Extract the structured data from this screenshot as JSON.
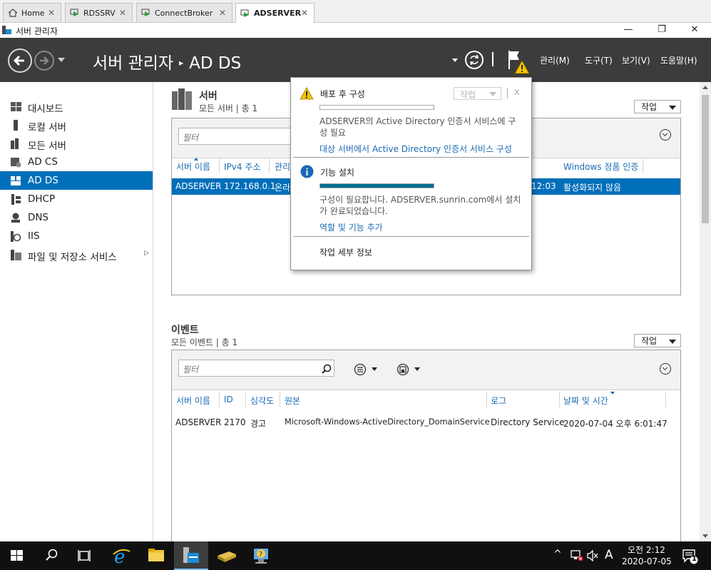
{
  "tabs": [
    {
      "label": "Home",
      "icon": "home-icon"
    },
    {
      "label": "RDSSRV",
      "icon": "remote-desktop-icon"
    },
    {
      "label": "ConnectBroker",
      "icon": "remote-desktop-icon"
    },
    {
      "label": "ADSERVER",
      "icon": "remote-desktop-icon",
      "active": true
    }
  ],
  "window": {
    "title": "서버 관리자",
    "minimize": "—",
    "restore": "❐",
    "close": "✕"
  },
  "header": {
    "app": "서버 관리자",
    "page": "AD DS",
    "menu": [
      "관리(M)",
      "도구(T)",
      "보기(V)",
      "도움말(H)"
    ]
  },
  "sidebar": {
    "items": [
      {
        "label": "대시보드",
        "icon": "dashboard-icon"
      },
      {
        "label": "로컬 서버",
        "icon": "local-server-icon"
      },
      {
        "label": "모든 서버",
        "icon": "all-servers-icon"
      },
      {
        "label": "AD CS",
        "icon": "ad-cs-icon"
      },
      {
        "label": "AD DS",
        "icon": "ad-ds-icon",
        "selected": true
      },
      {
        "label": "DHCP",
        "icon": "dhcp-icon"
      },
      {
        "label": "DNS",
        "icon": "dns-icon"
      },
      {
        "label": "IIS",
        "icon": "iis-icon"
      },
      {
        "label": "파일 및 저장소 서비스",
        "icon": "file-storage-icon",
        "has_arrow": true
      }
    ]
  },
  "servers": {
    "title": "서버",
    "subtitle": "모든 서버 | 총 1",
    "task_label": "작업",
    "filter_placeholder": "필터",
    "columns": [
      "서버 이름",
      "IPv4 주소",
      "관리",
      "Windows 정품 인증"
    ],
    "row": {
      "name": "ADSERVER",
      "ip": "172.168.0.1",
      "manage": "온라",
      "time_fragment": "12:03",
      "activation": "활성화되지 않음"
    }
  },
  "events": {
    "title": "이벤트",
    "subtitle": "모든 이벤트 | 총 1",
    "task_label": "작업",
    "filter_placeholder": "필터",
    "columns": [
      "서버 이름",
      "ID",
      "심각도",
      "원본",
      "로그",
      "날짜 및 시간"
    ],
    "row": {
      "server": "ADSERVER",
      "id": "2170",
      "severity": "경고",
      "source": "Microsoft-Windows-ActiveDirectory_DomainService",
      "log": "Directory Service",
      "datetime": "2020-07-04 오후 6:01:47"
    }
  },
  "notifications": {
    "task_label": "작업",
    "close": "x",
    "items": [
      {
        "icon": "warning-icon",
        "title": "배포 후 구성",
        "progress": 0,
        "text": [
          "ADSERVER의 Active Directory 인증서 서비스에 구",
          "성 필요"
        ],
        "link": "대상 서버에서 Active Directory 인증서 서비스 구성"
      },
      {
        "icon": "info-icon",
        "title": "기능 설치",
        "progress": 1,
        "text": [
          "구성이 필요합니다. ADSERVER.sunrin.com에서 설치",
          "가 완료되었습니다."
        ],
        "link": "역할 및 기능 추가"
      }
    ],
    "footer": "작업 세부 정보"
  },
  "taskbar": {
    "time": "오전 2:12",
    "date": "2020-07-05",
    "ime": "A",
    "notification_count": "1"
  },
  "colors": {
    "accent": "#006fba",
    "header": "#3c3c3c",
    "link": "#1a6bb5",
    "warning": "#f5c400"
  }
}
